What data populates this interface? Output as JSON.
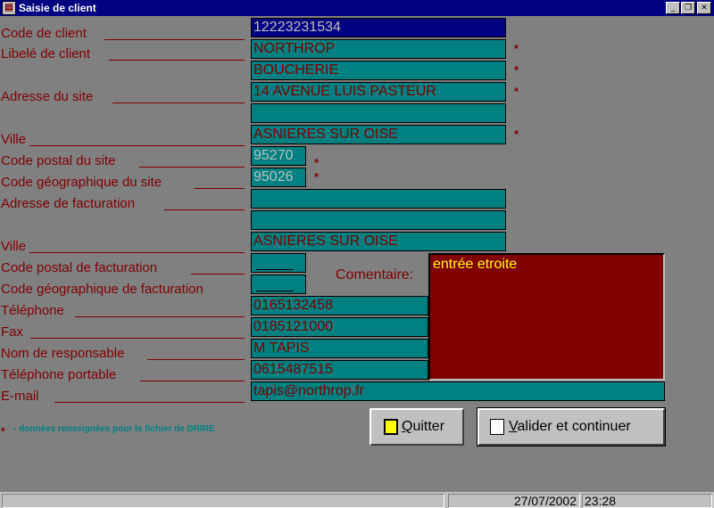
{
  "window": {
    "title": "Saisie de client",
    "icon": "app-form-icon"
  },
  "form": {
    "labels": {
      "code_client": "Code de client",
      "libelle": "Libelé de client",
      "adresse_site": "Adresse du site",
      "ville": "Ville",
      "cp_site": "Code postal du site",
      "geo_site": "Code géographique du site",
      "adresse_fact": "Adresse de facturation",
      "ville_fact": "Ville",
      "cp_fact": "Code postal de facturation",
      "geo_fact": "Code géographique de facturation",
      "telephone": "Téléphone",
      "fax": "Fax",
      "responsable": "Nom de responsable",
      "portable": "Téléphone portable",
      "email": "E-mail",
      "commentaire": "Comentaire:"
    },
    "values": {
      "code_client": "12223231534",
      "libelle_1": "NORTHROP",
      "libelle_2": "BOUCHERIE",
      "adresse_site_1": "14 AVENUE LUIS PASTEUR",
      "adresse_site_2": "",
      "ville": "ASNIERES SUR OISE",
      "cp_site": "95270",
      "geo_site": "95026",
      "adresse_fact_1": "",
      "adresse_fact_2": "",
      "ville_fact": "ASNIERES SUR OISE",
      "cp_fact": "",
      "geo_fact": "",
      "telephone": "0165132458",
      "fax": "0185121000",
      "responsable": "M TAPIS",
      "portable": "0615487515",
      "email": "tapis@northrop.fr",
      "commentaire": "entrée etroite"
    },
    "required_mark": "*",
    "legend": "- données renseignées pour le fichier de DRIRE"
  },
  "buttons": {
    "quit_prefix": "Q",
    "quit_rest": "uitter",
    "validate_prefix": "V",
    "validate_rest": "alider et continuer"
  },
  "status": {
    "date": "27/07/2002",
    "time": "23:28"
  },
  "colors": {
    "label": "#800000",
    "field": "#008080",
    "selected_field": "#000080",
    "comment_bg": "#800000",
    "comment_text": "#ffff00",
    "legend": "#008080"
  }
}
